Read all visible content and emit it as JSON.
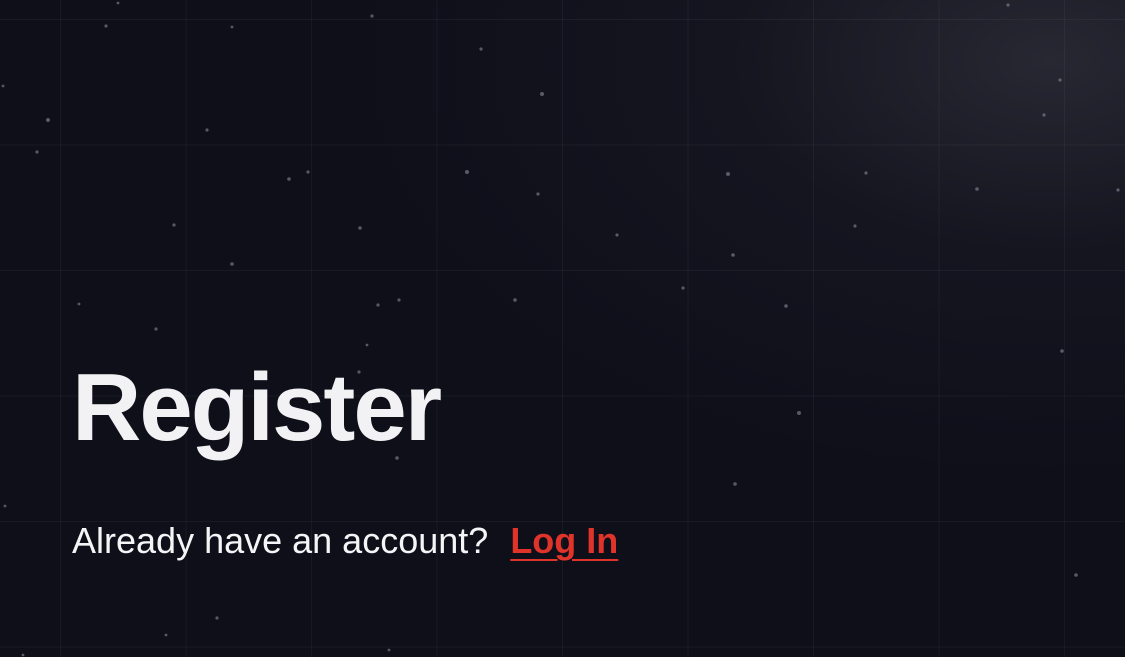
{
  "page": {
    "title": "Register",
    "prompt_text": "Already have an account?",
    "login_link_label": "Log In"
  },
  "colors": {
    "background": "#0f0f1a",
    "title": "#f2f2f4",
    "accent_link": "#e0332a"
  }
}
